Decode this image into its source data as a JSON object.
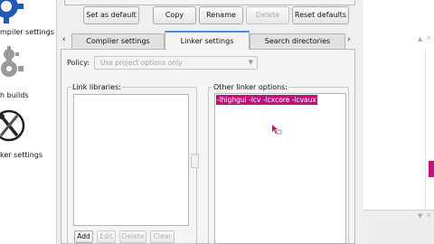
{
  "left_categories": [
    {
      "label": "mpiler settings",
      "icon": "gear-icon"
    },
    {
      "label": "h builds",
      "icon": "gear-icon"
    },
    {
      "label": "ker settings",
      "icon": "tools-icon"
    }
  ],
  "toolbar": {
    "set_default": "Set as default",
    "copy": "Copy",
    "rename": "Rename",
    "delete": "Delete",
    "reset_defaults": "Reset defaults"
  },
  "tabs": {
    "left_arrow": "‹",
    "right_arrow": "›",
    "items": [
      "Compiler settings",
      "Linker settings",
      "Search directories"
    ],
    "active": "Linker settings"
  },
  "policy": {
    "label": "Policy:",
    "value": "Use project options only"
  },
  "link_libraries": {
    "title": "Link libraries:",
    "buttons": {
      "add": "Add",
      "edit": "Edit",
      "delete": "Delete",
      "clear": "Clear"
    }
  },
  "other_linker_options": {
    "title": "Other linker options:",
    "text": "-lhighgui -lcv -lcxcore -lcvaux"
  },
  "colors": {
    "selection": "#c1117f",
    "tab_accent": "#4a90d9",
    "accent_bar": "#c1117f"
  },
  "right_panel": {
    "up_arrow": "▲",
    "close": "×",
    "down_arrow": "▼"
  }
}
